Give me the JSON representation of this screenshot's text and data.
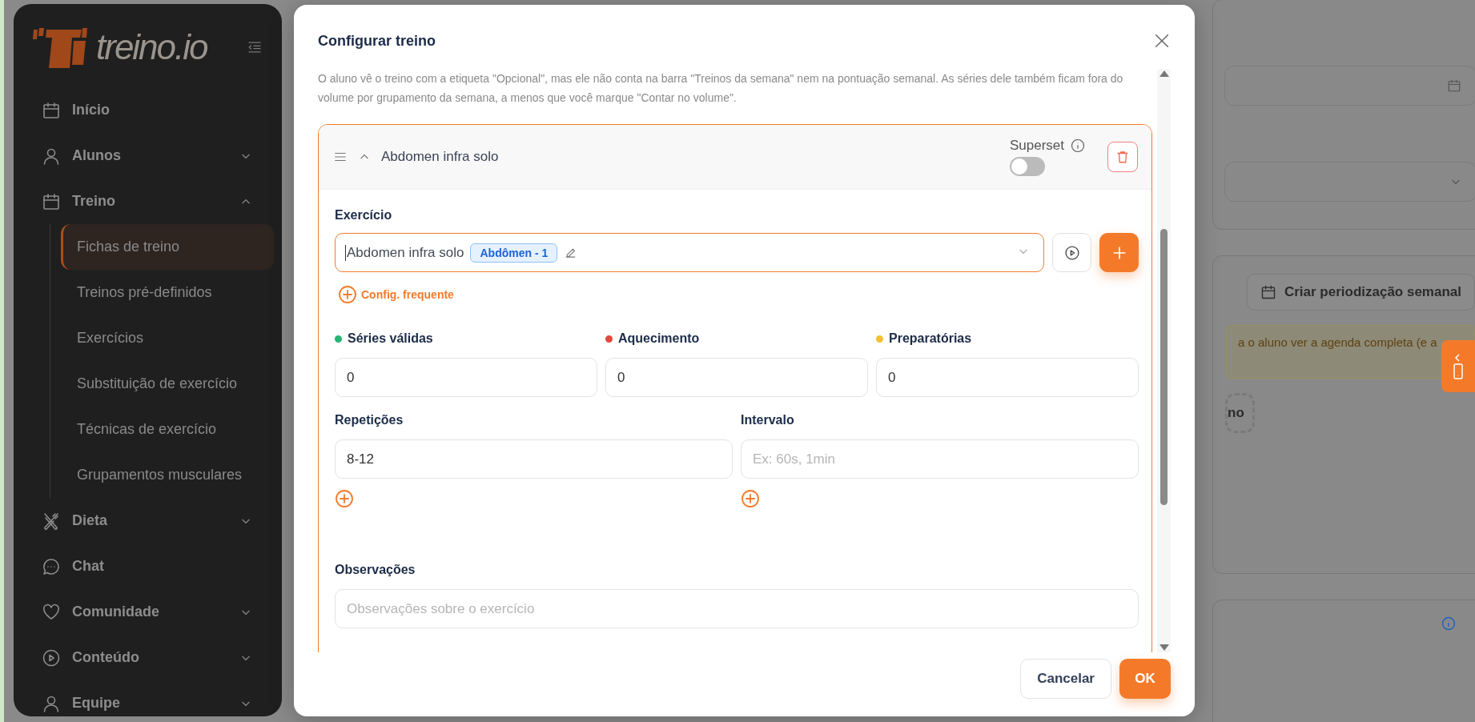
{
  "sidebar": {
    "logo_text": "treino.io",
    "items": [
      {
        "label": "Início"
      },
      {
        "label": "Alunos",
        "expanded": false
      },
      {
        "label": "Treino",
        "expanded": true,
        "children": [
          {
            "label": "Fichas de treino",
            "selected": true
          },
          {
            "label": "Treinos pré-definidos",
            "selected": false
          },
          {
            "label": "Exercícios",
            "selected": false
          },
          {
            "label": "Substituição de exercício",
            "selected": false
          },
          {
            "label": "Técnicas de exercício",
            "selected": false
          },
          {
            "label": "Grupamentos musculares",
            "selected": false
          }
        ]
      },
      {
        "label": "Dieta",
        "expanded": false
      },
      {
        "label": "Chat"
      },
      {
        "label": "Comunidade",
        "expanded": false
      },
      {
        "label": "Conteúdo",
        "expanded": false
      },
      {
        "label": "Equipe",
        "expanded": false
      }
    ]
  },
  "background": {
    "period_button": "Criar periodização semanal",
    "alert": "a o aluno ver a agenda completa (e a",
    "dashed_button": "no"
  },
  "modal": {
    "title": "Configurar treino",
    "description": "O aluno vê o treino com a etiqueta \"Opcional\", mas ele não conta na barra \"Treinos da semana\" nem na pontuação semanal. As séries dele também ficam fora do volume por grupamento da semana, a menos que você marque \"Contar no volume\".",
    "exercise": {
      "name": "Abdomen infra solo",
      "expanded": true,
      "superset": {
        "label": "Superset",
        "on": false
      },
      "exercise_label": "Exercício",
      "exercise_value": "Abdomen infra solo",
      "tag": "Abdômen - 1",
      "config_link": "Config. frequente",
      "series": [
        {
          "label": "Séries válidas",
          "color": "#22b573",
          "value": "0"
        },
        {
          "label": "Aquecimento",
          "color": "#e5463a",
          "value": "0"
        },
        {
          "label": "Preparatórias",
          "color": "#f5c133",
          "value": "0"
        }
      ],
      "reps_label": "Repetições",
      "reps_value": "8-12",
      "interval_label": "Intervalo",
      "interval_placeholder": "Ex: 60s, 1min",
      "notes_label": "Observações",
      "notes_placeholder": "Observações sobre o exercício"
    },
    "buttons": {
      "cancel": "Cancelar",
      "ok": "OK"
    }
  }
}
